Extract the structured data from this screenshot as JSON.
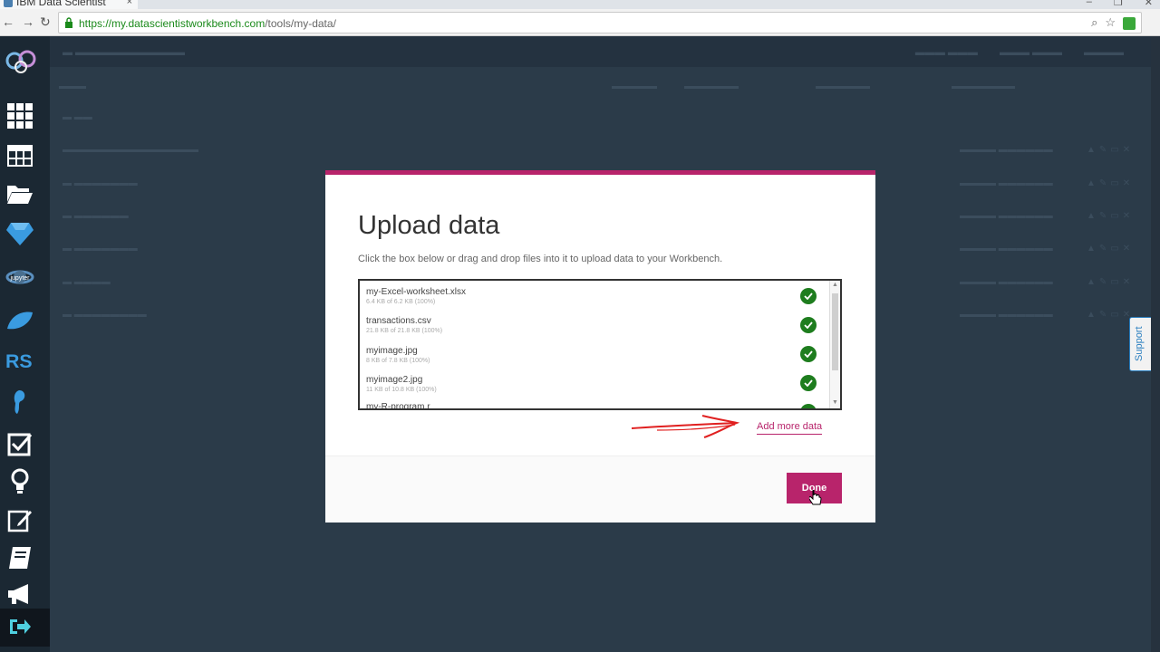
{
  "browser": {
    "tab_title": "IBM Data Scientist",
    "tab_close": "×",
    "url_host": "https://my.datascientistworkbench.com",
    "url_path": "/tools/my-data/"
  },
  "modal": {
    "title": "Upload data",
    "description": "Click the box below or drag and drop files into it to upload data to your Workbench.",
    "files": [
      {
        "name": "my-Excel-worksheet.xlsx",
        "progress": "6.4 KB of 6.2 KB (100%)",
        "status": "complete"
      },
      {
        "name": "transactions.csv",
        "progress": "21.8 KB of 21.8 KB (100%)",
        "status": "complete"
      },
      {
        "name": "myimage.jpg",
        "progress": "8 KB of 7.8 KB (100%)",
        "status": "complete"
      },
      {
        "name": "myimage2.jpg",
        "progress": "11 KB of 10.8 KB (100%)",
        "status": "complete"
      },
      {
        "name": "my-R-program.r",
        "progress": "",
        "status": "complete"
      }
    ],
    "add_more_label": "Add more data",
    "done_label": "Done"
  },
  "support_label": "Support",
  "colors": {
    "accent": "#b8246b",
    "success": "#1e7d1e",
    "sidebar": "#1b2833"
  }
}
